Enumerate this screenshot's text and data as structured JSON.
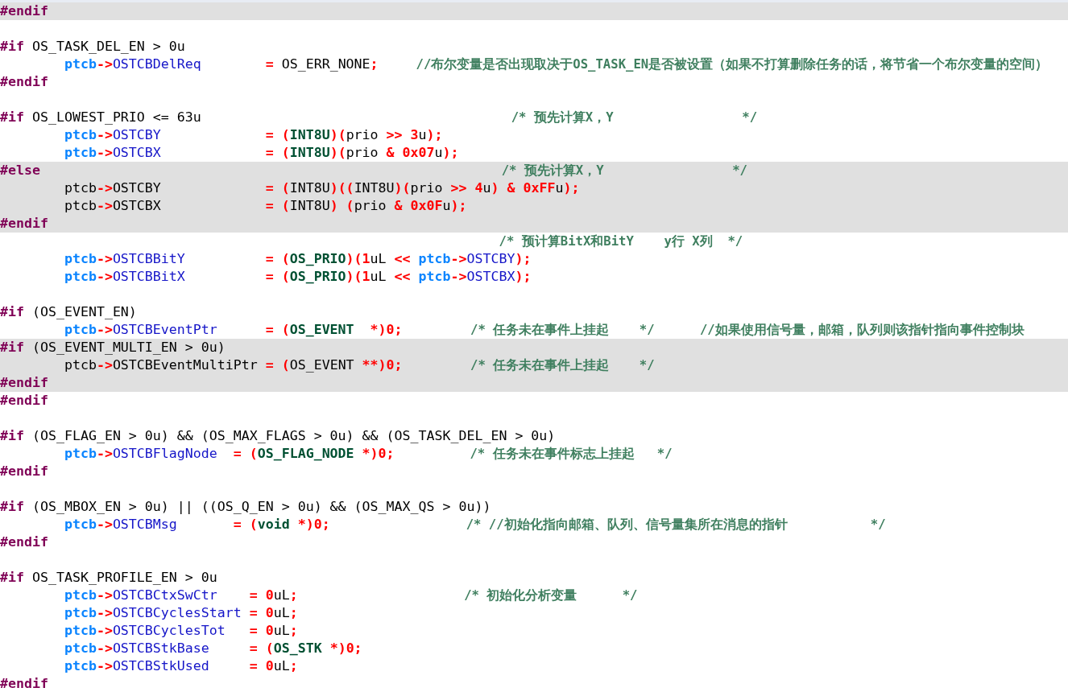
{
  "editor": {
    "lines": [
      {
        "inactive": true,
        "tokens": [
          {
            "kind": "directive",
            "text": "#endif"
          }
        ]
      },
      {
        "inactive": false
      },
      {
        "inactive": false,
        "tokens": [
          {
            "kind": "directive",
            "text": "#if"
          },
          {
            "kind": "plain",
            "text": " OS_TASK_DEL_EN > 0u"
          }
        ]
      },
      {
        "inactive": false,
        "tokens": [
          {
            "kind": "pointer",
            "text": "        ptcb"
          },
          {
            "kind": "op",
            "text": "->"
          },
          {
            "kind": "field",
            "text": "OSTCBDelReq"
          },
          {
            "kind": "op",
            "text": "        ="
          },
          {
            "kind": "plain",
            "text": " OS_ERR_NONE"
          },
          {
            "kind": "op",
            "text": ";"
          },
          {
            "kind": "comment",
            "text": "     //布尔变量是否出现取决于OS_TASK_EN是否被设置（如果不打算删除任务的话，将节省一个布尔变量的空间）"
          }
        ]
      },
      {
        "inactive": false,
        "tokens": [
          {
            "kind": "directive",
            "text": "#endif"
          }
        ]
      },
      {
        "inactive": false
      },
      {
        "inactive": false,
        "tokens": [
          {
            "kind": "directive",
            "text": "#if"
          },
          {
            "kind": "plain",
            "text": " OS_LOWEST_PRIO <= 63u"
          },
          {
            "kind": "comment",
            "text": "                                         /* 预先计算X，Y                 */"
          }
        ]
      },
      {
        "inactive": false,
        "tokens": [
          {
            "kind": "pointer",
            "text": "        ptcb"
          },
          {
            "kind": "op",
            "text": "->"
          },
          {
            "kind": "field",
            "text": "OSTCBY"
          },
          {
            "kind": "op",
            "text": "             = ("
          },
          {
            "kind": "type",
            "text": "INT8U"
          },
          {
            "kind": "op",
            "text": ")("
          },
          {
            "kind": "plain",
            "text": "prio "
          },
          {
            "kind": "op",
            "text": ">>"
          },
          {
            "kind": "number",
            "text": " 3"
          },
          {
            "kind": "plain",
            "text": "u"
          },
          {
            "kind": "op",
            "text": ");"
          }
        ]
      },
      {
        "inactive": false,
        "tokens": [
          {
            "kind": "pointer",
            "text": "        ptcb"
          },
          {
            "kind": "op",
            "text": "->"
          },
          {
            "kind": "field",
            "text": "OSTCBX"
          },
          {
            "kind": "op",
            "text": "             = ("
          },
          {
            "kind": "type",
            "text": "INT8U"
          },
          {
            "kind": "op",
            "text": ")("
          },
          {
            "kind": "plain",
            "text": "prio "
          },
          {
            "kind": "op",
            "text": "&"
          },
          {
            "kind": "number",
            "text": " 0x07"
          },
          {
            "kind": "plain",
            "text": "u"
          },
          {
            "kind": "op",
            "text": ");"
          }
        ]
      },
      {
        "inactive": true,
        "tokens": [
          {
            "kind": "directive",
            "text": "#else"
          },
          {
            "kind": "comment",
            "text": "                                                             /* 预先计算X，Y                 */"
          }
        ]
      },
      {
        "inactive": true,
        "tokens": [
          {
            "kind": "plain",
            "text": "        ptcb"
          },
          {
            "kind": "op",
            "text": "->"
          },
          {
            "kind": "plain",
            "text": "OSTCBY             "
          },
          {
            "kind": "op",
            "text": "= ("
          },
          {
            "kind": "plain",
            "text": "INT8U"
          },
          {
            "kind": "op",
            "text": ")(("
          },
          {
            "kind": "plain",
            "text": "INT8U"
          },
          {
            "kind": "op",
            "text": ")("
          },
          {
            "kind": "plain",
            "text": "prio "
          },
          {
            "kind": "op",
            "text": ">>"
          },
          {
            "kind": "number",
            "text": " 4"
          },
          {
            "kind": "plain",
            "text": "u"
          },
          {
            "kind": "op",
            "text": ") &"
          },
          {
            "kind": "number",
            "text": " 0xFF"
          },
          {
            "kind": "plain",
            "text": "u"
          },
          {
            "kind": "op",
            "text": ");"
          }
        ]
      },
      {
        "inactive": true,
        "tokens": [
          {
            "kind": "plain",
            "text": "        ptcb"
          },
          {
            "kind": "op",
            "text": "->"
          },
          {
            "kind": "plain",
            "text": "OSTCBX             "
          },
          {
            "kind": "op",
            "text": "= ("
          },
          {
            "kind": "plain",
            "text": "INT8U"
          },
          {
            "kind": "op",
            "text": ") ("
          },
          {
            "kind": "plain",
            "text": "prio "
          },
          {
            "kind": "op",
            "text": "&"
          },
          {
            "kind": "number",
            "text": " 0x0F"
          },
          {
            "kind": "plain",
            "text": "u"
          },
          {
            "kind": "op",
            "text": ");"
          }
        ]
      },
      {
        "inactive": true,
        "tokens": [
          {
            "kind": "directive",
            "text": "#endif"
          }
        ]
      },
      {
        "inactive": false,
        "tokens": [
          {
            "kind": "comment",
            "text": "                                                                  /* 预计算BitX和BitY    y行 X列  */"
          }
        ]
      },
      {
        "inactive": false,
        "tokens": [
          {
            "kind": "pointer",
            "text": "        ptcb"
          },
          {
            "kind": "op",
            "text": "->"
          },
          {
            "kind": "field",
            "text": "OSTCBBitY"
          },
          {
            "kind": "op",
            "text": "          = ("
          },
          {
            "kind": "type",
            "text": "OS_PRIO"
          },
          {
            "kind": "op",
            "text": ")("
          },
          {
            "kind": "number",
            "text": "1"
          },
          {
            "kind": "plain",
            "text": "uL "
          },
          {
            "kind": "op",
            "text": "<<"
          },
          {
            "kind": "pointer",
            "text": " ptcb"
          },
          {
            "kind": "op",
            "text": "->"
          },
          {
            "kind": "field",
            "text": "OSTCBY"
          },
          {
            "kind": "op",
            "text": ");"
          }
        ]
      },
      {
        "inactive": false,
        "tokens": [
          {
            "kind": "pointer",
            "text": "        ptcb"
          },
          {
            "kind": "op",
            "text": "->"
          },
          {
            "kind": "field",
            "text": "OSTCBBitX"
          },
          {
            "kind": "op",
            "text": "          = ("
          },
          {
            "kind": "type",
            "text": "OS_PRIO"
          },
          {
            "kind": "op",
            "text": ")("
          },
          {
            "kind": "number",
            "text": "1"
          },
          {
            "kind": "plain",
            "text": "uL "
          },
          {
            "kind": "op",
            "text": "<<"
          },
          {
            "kind": "pointer",
            "text": " ptcb"
          },
          {
            "kind": "op",
            "text": "->"
          },
          {
            "kind": "field",
            "text": "OSTCBX"
          },
          {
            "kind": "op",
            "text": ");"
          }
        ]
      },
      {
        "inactive": false
      },
      {
        "inactive": false,
        "tokens": [
          {
            "kind": "directive",
            "text": "#if"
          },
          {
            "kind": "plain",
            "text": " (OS_EVENT_EN)"
          }
        ]
      },
      {
        "inactive": false,
        "tokens": [
          {
            "kind": "pointer",
            "text": "        ptcb"
          },
          {
            "kind": "op",
            "text": "->"
          },
          {
            "kind": "field",
            "text": "OSTCBEventPtr"
          },
          {
            "kind": "op",
            "text": "      = ("
          },
          {
            "kind": "type",
            "text": "OS_EVENT"
          },
          {
            "kind": "op",
            "text": "  *)0;"
          },
          {
            "kind": "comment",
            "text": "         /* 任务未在事件上挂起    */"
          },
          {
            "kind": "comment",
            "text": "      //如果使用信号量，邮箱，队列则该指针指向事件控制块"
          }
        ]
      },
      {
        "inactive": true,
        "tokens": [
          {
            "kind": "directive",
            "text": "#if"
          },
          {
            "kind": "plain",
            "text": " (OS_EVENT_MULTI_EN > 0u)"
          }
        ]
      },
      {
        "inactive": true,
        "tokens": [
          {
            "kind": "plain",
            "text": "        ptcb"
          },
          {
            "kind": "op",
            "text": "->"
          },
          {
            "kind": "plain",
            "text": "OSTCBEventMultiPtr "
          },
          {
            "kind": "op",
            "text": "= ("
          },
          {
            "kind": "plain",
            "text": "OS_EVENT "
          },
          {
            "kind": "op",
            "text": "**)0;"
          },
          {
            "kind": "comment",
            "text": "         /* 任务未在事件上挂起    */"
          }
        ]
      },
      {
        "inactive": true,
        "tokens": [
          {
            "kind": "directive",
            "text": "#endif"
          }
        ]
      },
      {
        "inactive": false,
        "tokens": [
          {
            "kind": "directive",
            "text": "#endif"
          }
        ]
      },
      {
        "inactive": false
      },
      {
        "inactive": false,
        "tokens": [
          {
            "kind": "directive",
            "text": "#if"
          },
          {
            "kind": "plain",
            "text": " (OS_FLAG_EN > 0u) && (OS_MAX_FLAGS > 0u) && (OS_TASK_DEL_EN > 0u)"
          }
        ]
      },
      {
        "inactive": false,
        "tokens": [
          {
            "kind": "pointer",
            "text": "        ptcb"
          },
          {
            "kind": "op",
            "text": "->"
          },
          {
            "kind": "field",
            "text": "OSTCBFlagNode"
          },
          {
            "kind": "op",
            "text": "  = ("
          },
          {
            "kind": "type",
            "text": "OS_FLAG_NODE"
          },
          {
            "kind": "op",
            "text": " *)0;"
          },
          {
            "kind": "comment",
            "text": "          /* 任务未在事件标志上挂起   */"
          }
        ]
      },
      {
        "inactive": false,
        "tokens": [
          {
            "kind": "directive",
            "text": "#endif"
          }
        ]
      },
      {
        "inactive": false
      },
      {
        "inactive": false,
        "tokens": [
          {
            "kind": "directive",
            "text": "#if"
          },
          {
            "kind": "plain",
            "text": " (OS_MBOX_EN > 0u) || ((OS_Q_EN > 0u) && (OS_MAX_QS > 0u))"
          }
        ]
      },
      {
        "inactive": false,
        "tokens": [
          {
            "kind": "pointer",
            "text": "        ptcb"
          },
          {
            "kind": "op",
            "text": "->"
          },
          {
            "kind": "field",
            "text": "OSTCBMsg"
          },
          {
            "kind": "op",
            "text": "       = ("
          },
          {
            "kind": "type",
            "text": "void"
          },
          {
            "kind": "op",
            "text": " *)0;"
          },
          {
            "kind": "comment",
            "text": "                  /* //初始化指向邮箱、队列、信号量集所在消息的指针           */"
          }
        ]
      },
      {
        "inactive": false,
        "tokens": [
          {
            "kind": "directive",
            "text": "#endif"
          }
        ]
      },
      {
        "inactive": false
      },
      {
        "inactive": false,
        "tokens": [
          {
            "kind": "directive",
            "text": "#if"
          },
          {
            "kind": "plain",
            "text": " OS_TASK_PROFILE_EN > 0u"
          }
        ]
      },
      {
        "inactive": false,
        "tokens": [
          {
            "kind": "pointer",
            "text": "        ptcb"
          },
          {
            "kind": "op",
            "text": "->"
          },
          {
            "kind": "field",
            "text": "OSTCBCtxSwCtr"
          },
          {
            "kind": "op",
            "text": "    = "
          },
          {
            "kind": "number",
            "text": "0"
          },
          {
            "kind": "plain",
            "text": "uL"
          },
          {
            "kind": "op",
            "text": ";"
          },
          {
            "kind": "comment",
            "text": "                      /* 初始化分析变量      */"
          }
        ]
      },
      {
        "inactive": false,
        "tokens": [
          {
            "kind": "pointer",
            "text": "        ptcb"
          },
          {
            "kind": "op",
            "text": "->"
          },
          {
            "kind": "field",
            "text": "OSTCBCyclesStart"
          },
          {
            "kind": "op",
            "text": " = "
          },
          {
            "kind": "number",
            "text": "0"
          },
          {
            "kind": "plain",
            "text": "uL"
          },
          {
            "kind": "op",
            "text": ";"
          }
        ]
      },
      {
        "inactive": false,
        "tokens": [
          {
            "kind": "pointer",
            "text": "        ptcb"
          },
          {
            "kind": "op",
            "text": "->"
          },
          {
            "kind": "field",
            "text": "OSTCBCyclesTot"
          },
          {
            "kind": "op",
            "text": "   = "
          },
          {
            "kind": "number",
            "text": "0"
          },
          {
            "kind": "plain",
            "text": "uL"
          },
          {
            "kind": "op",
            "text": ";"
          }
        ]
      },
      {
        "inactive": false,
        "tokens": [
          {
            "kind": "pointer",
            "text": "        ptcb"
          },
          {
            "kind": "op",
            "text": "->"
          },
          {
            "kind": "field",
            "text": "OSTCBStkBase"
          },
          {
            "kind": "op",
            "text": "     = ("
          },
          {
            "kind": "type",
            "text": "OS_STK"
          },
          {
            "kind": "op",
            "text": " *)0;"
          }
        ]
      },
      {
        "inactive": false,
        "tokens": [
          {
            "kind": "pointer",
            "text": "        ptcb"
          },
          {
            "kind": "op",
            "text": "->"
          },
          {
            "kind": "field",
            "text": "OSTCBStkUsed"
          },
          {
            "kind": "op",
            "text": "     = "
          },
          {
            "kind": "number",
            "text": "0"
          },
          {
            "kind": "plain",
            "text": "uL"
          },
          {
            "kind": "op",
            "text": ";"
          }
        ]
      },
      {
        "inactive": false,
        "tokens": [
          {
            "kind": "directive",
            "text": "#endif"
          }
        ]
      }
    ]
  }
}
